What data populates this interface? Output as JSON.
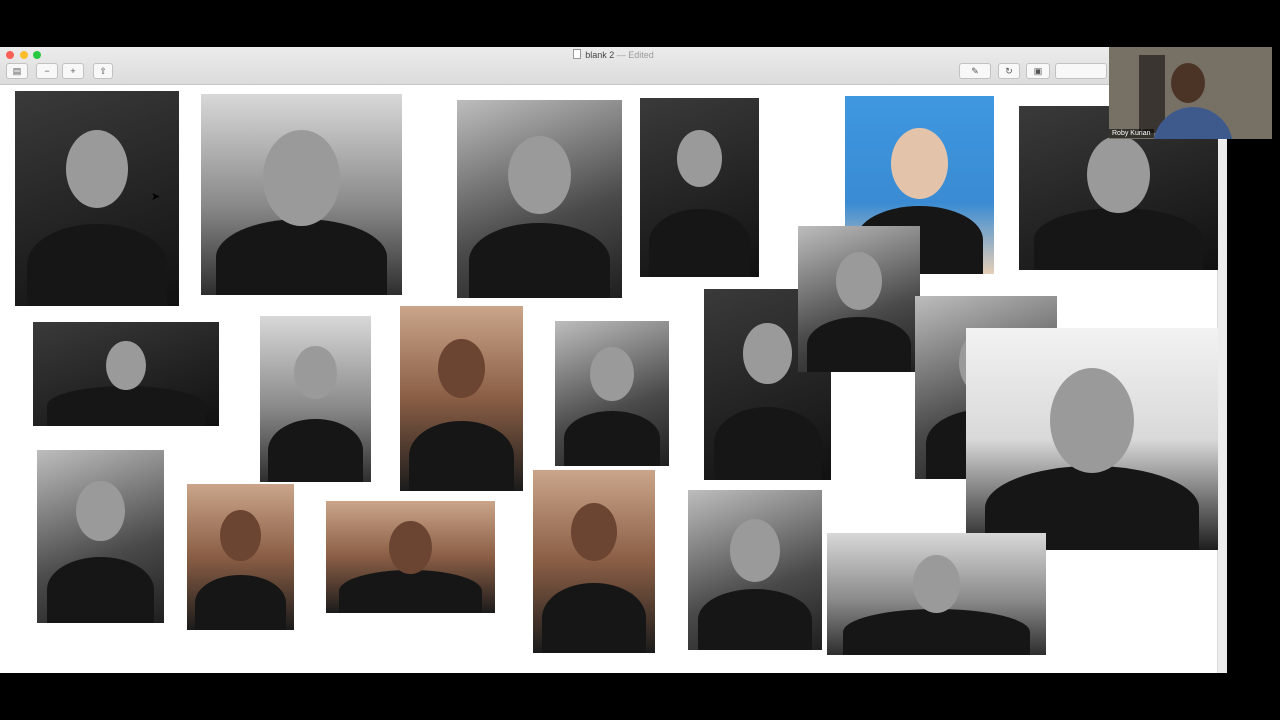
{
  "window": {
    "title": "blank 2",
    "edited": "— Edited",
    "toolbar": {
      "sidebar_toggle": "▤",
      "zoom_out": "−",
      "zoom_in": "+",
      "share": "⇧",
      "markup": "✎",
      "rotate": "↻",
      "toolbox": "▣"
    }
  },
  "video_call": {
    "participant_name": "Roby Kurian"
  },
  "collage": {
    "photos": [
      {
        "id": "p1",
        "tone": "dark"
      },
      {
        "id": "p2",
        "tone": "bw2"
      },
      {
        "id": "p3",
        "tone": "bw"
      },
      {
        "id": "p4",
        "tone": "dark"
      },
      {
        "id": "p5",
        "tone": "blue"
      },
      {
        "id": "p6",
        "tone": "dark"
      },
      {
        "id": "p7",
        "tone": "dark"
      },
      {
        "id": "p8",
        "tone": "bw2"
      },
      {
        "id": "p9",
        "tone": "warm"
      },
      {
        "id": "p10",
        "tone": "bw"
      },
      {
        "id": "p11",
        "tone": "dark"
      },
      {
        "id": "p12",
        "tone": "bw"
      },
      {
        "id": "p13",
        "tone": "bw"
      },
      {
        "id": "p14",
        "tone": "white-bg"
      },
      {
        "id": "p15",
        "tone": "bw"
      },
      {
        "id": "p16",
        "tone": "warm"
      },
      {
        "id": "p17",
        "tone": "warm"
      },
      {
        "id": "p18",
        "tone": "warm"
      },
      {
        "id": "p19",
        "tone": "bw"
      },
      {
        "id": "p20",
        "tone": "bw2"
      }
    ]
  }
}
